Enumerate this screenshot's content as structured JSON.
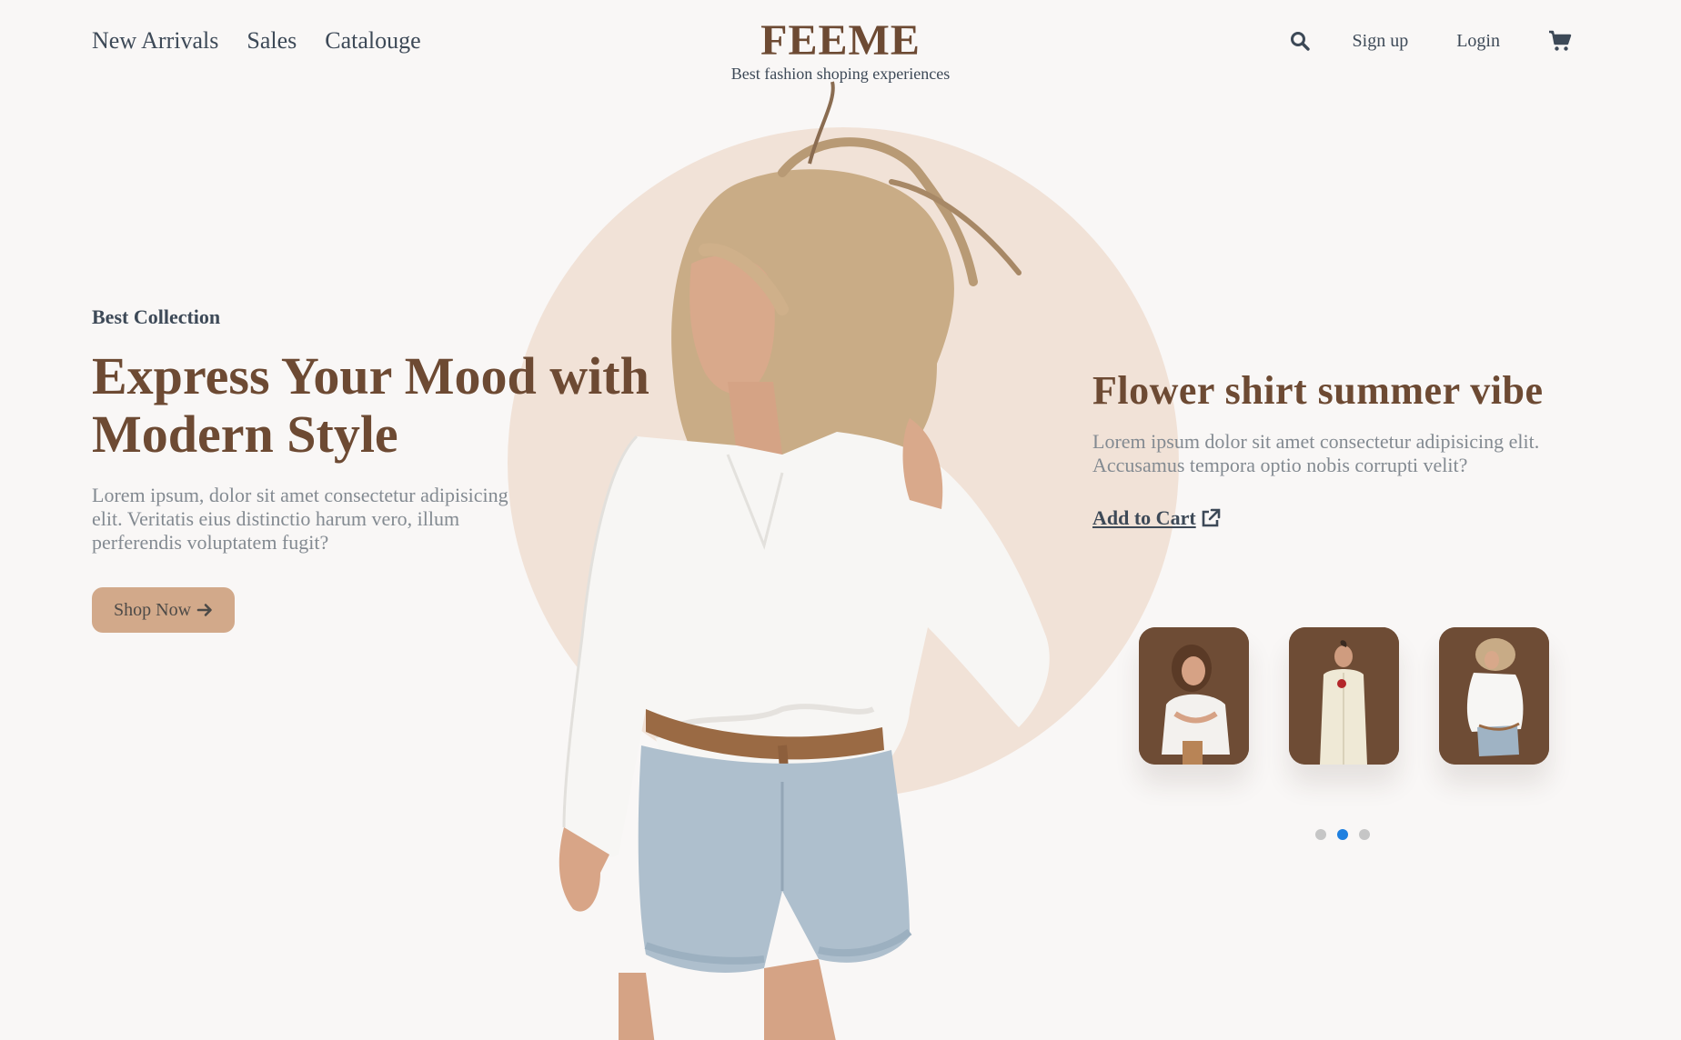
{
  "nav": {
    "links": [
      "New Arrivals",
      "Sales",
      "Catalouge"
    ],
    "brand": "FEEME",
    "tagline": "Best fashion shoping experiences",
    "signup": "Sign up",
    "login": "Login",
    "icons": {
      "search": "search-icon",
      "cart": "cart-icon"
    }
  },
  "hero": {
    "eyebrow": "Best Collection",
    "title_line1": "Express Your Mood with",
    "title_line2": "Modern Style",
    "description": "Lorem ipsum, dolor sit amet consectetur adipisicing elit. Veritatis eius distinctio harum vero, illum perferendis voluptatem fugit?",
    "cta": "Shop Now"
  },
  "product": {
    "title": "Flower shirt summer vibe",
    "description": "Lorem ipsum dolor sit amet consectetur adipisicing elit. Accusamus tempora optio nobis corrupti velit?",
    "add_to_cart": "Add to Cart"
  },
  "carousel": {
    "thumbnails": 3,
    "dots": 3,
    "active_dot": 2
  },
  "colors": {
    "background": "#f9f7f6",
    "brand": "#6d4a33",
    "accent_circle": "#f1e2d7",
    "button": "#d2a98a",
    "thumb_bg": "#6e4c35",
    "dot_active": "#1f80e0"
  }
}
